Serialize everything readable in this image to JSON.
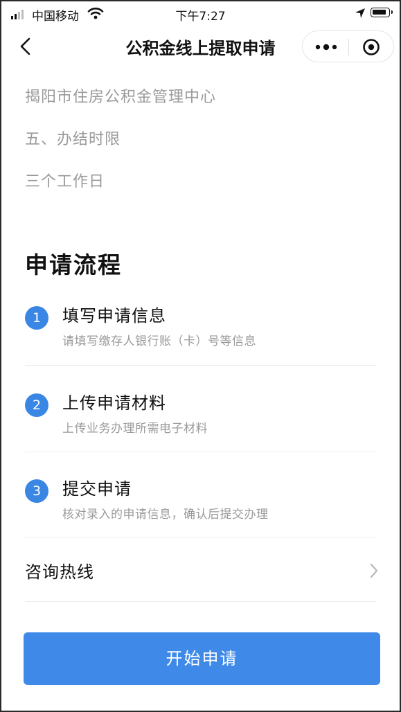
{
  "status_bar": {
    "carrier": "中国移动",
    "time": "下午7:27",
    "icons": [
      "signal-icon",
      "wifi-icon",
      "location-icon",
      "battery-icon"
    ]
  },
  "navbar": {
    "title": "公积金线上提取申请",
    "icons": [
      "back-chevron-icon",
      "more-dots-icon",
      "target-circle-icon"
    ]
  },
  "content": {
    "lines": [
      "揭阳市住房公积金管理中心",
      "五、办结时限",
      "三个工作日"
    ]
  },
  "process": {
    "title": "申请流程",
    "steps": [
      {
        "number": "1",
        "title": "填写申请信息",
        "desc": "请填写缴存人银行账（卡）号等信息"
      },
      {
        "number": "2",
        "title": "上传申请材料",
        "desc": "上传业务办理所需电子材料"
      },
      {
        "number": "3",
        "title": "提交申请",
        "desc": "核对录入的申请信息，确认后提交办理"
      }
    ]
  },
  "hotline": {
    "label": "咨询热线",
    "icon": "chevron-right-icon"
  },
  "actions": {
    "start_label": "开始申请"
  },
  "colors": {
    "accent": "#3f8ae8",
    "step_badge": "#3a86e4",
    "muted_text": "#9a9a9a",
    "divider": "#ececec"
  }
}
